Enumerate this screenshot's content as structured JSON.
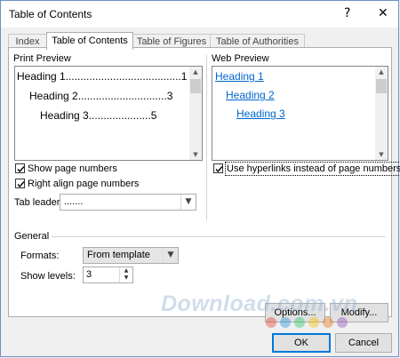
{
  "window": {
    "title": "Table of Contents",
    "help_label": "?",
    "close_label": "✕"
  },
  "tabs": [
    {
      "label": "Index",
      "active": false
    },
    {
      "label": "Table of Contents",
      "active": true
    },
    {
      "label": "Table of Figures",
      "active": false
    },
    {
      "label": "Table of Authorities",
      "active": false
    }
  ],
  "print_preview": {
    "label": "Print Preview",
    "lines": [
      {
        "text": "Heading 1.......................................1"
      },
      {
        "text": "Heading 2..............................3"
      },
      {
        "text": "Heading 3.....................5"
      }
    ],
    "show_page_numbers": {
      "label": "Show page numbers",
      "checked": true
    },
    "right_align": {
      "label": "Right align page numbers",
      "checked": true
    },
    "tab_leader": {
      "label": "Tab leader:",
      "value": "......."
    }
  },
  "web_preview": {
    "label": "Web Preview",
    "links": [
      "Heading 1",
      "Heading 2",
      "Heading 3"
    ],
    "use_hyperlinks": {
      "label": "Use hyperlinks instead of page numbers",
      "checked": true
    }
  },
  "general": {
    "label": "General",
    "formats": {
      "label": "Formats:",
      "value": "From template"
    },
    "show_levels": {
      "label": "Show levels:",
      "value": "3"
    }
  },
  "buttons": {
    "options": "Options...",
    "modify": "Modify...",
    "ok": "OK",
    "cancel": "Cancel"
  },
  "watermark": {
    "text": "Download.com.vn",
    "dot_colors": [
      "#e74c3c",
      "#3498db",
      "#2ecc71",
      "#f1c40f",
      "#e67e22",
      "#9b59b6"
    ]
  },
  "icons": {
    "checkmark": "check-icon",
    "dropdown": "chevron-down-icon",
    "scroll_up": "scroll-up-arrow-icon",
    "scroll_down": "scroll-down-arrow-icon"
  }
}
